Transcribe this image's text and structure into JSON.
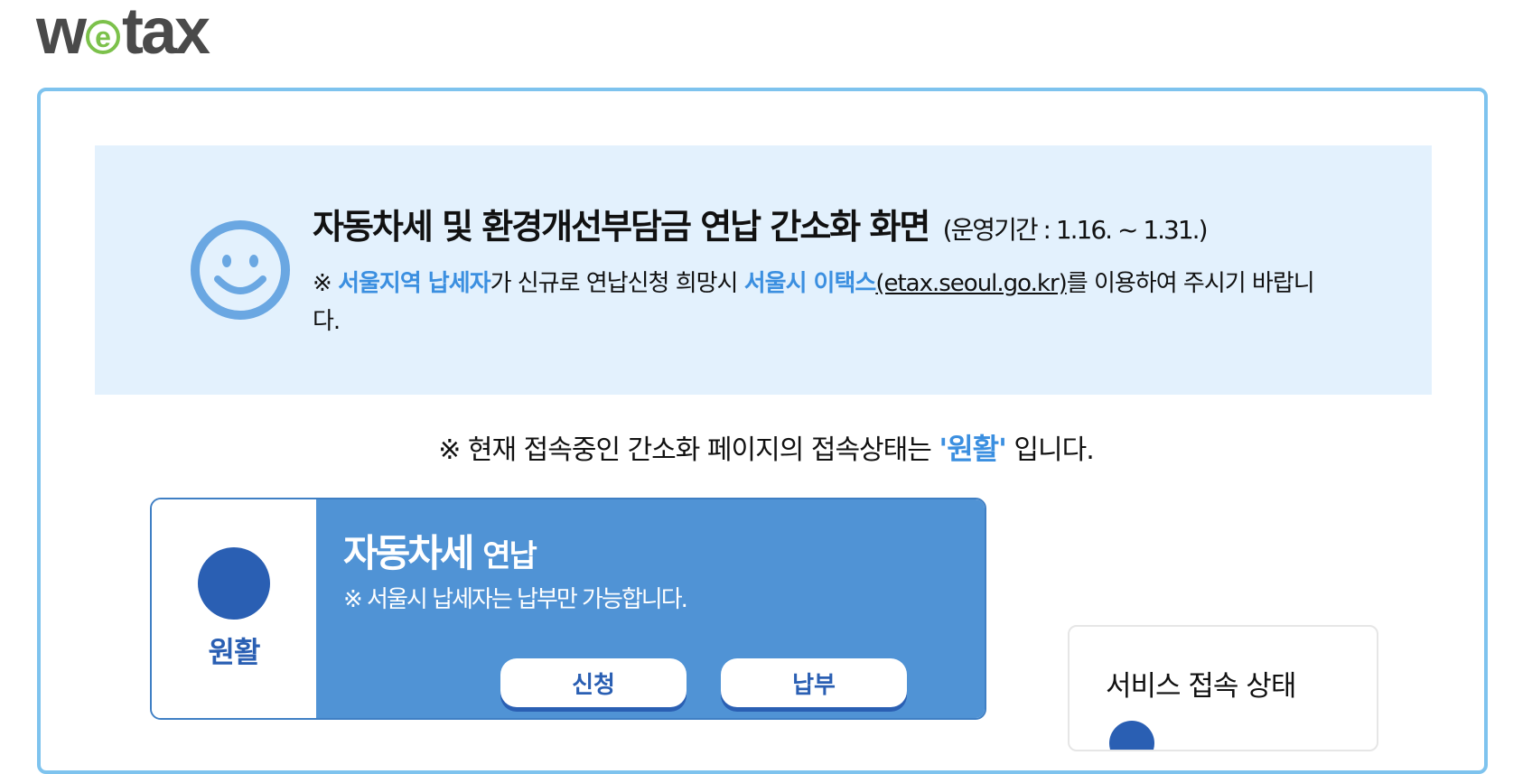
{
  "logo": {
    "pre": "w",
    "e": "e",
    "post": "tax"
  },
  "notice": {
    "title": "자동차세 및 환경개선부담금 연납 간소화 화면",
    "period": "(운영기간 : 1.16. ~ 1.31.)",
    "prefix": "※ ",
    "hl1": "서울지역 납세자",
    "mid": "가 신규로 연납신청 희망시 ",
    "hl2": "서울시 이택스",
    "link": "(etax.seoul.go.kr)",
    "suffix": "를 이용하여 주시기 바랍니다."
  },
  "status_line": {
    "prefix": "※ 현재 접속중인 간소화 페이지의 접속상태는 ",
    "value": "'원활'",
    "suffix": " 입니다."
  },
  "service": {
    "status": "원활",
    "title": "자동차세",
    "title_sub": "연납",
    "note": "※ 서울시 납세자는 납부만 가능합니다.",
    "apply_label": "신청",
    "pay_label": "납부"
  },
  "side_panel": {
    "title": "서비스 접속 상태"
  },
  "colors": {
    "accent_blue": "#3b8fe0",
    "card_blue": "#5093d5",
    "dark_blue": "#2a5fb3",
    "frame_border": "#7ec3ee",
    "notice_bg": "#e3f1fd",
    "logo_green": "#7cc14b"
  },
  "icons": {
    "notice_icon": "smiley-face-icon",
    "status_icon": "status-dot-icon"
  }
}
